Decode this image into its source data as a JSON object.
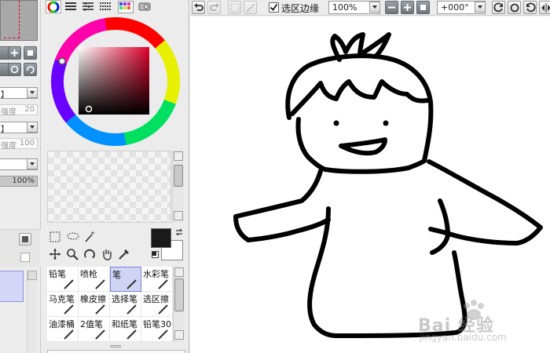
{
  "toolbar": {
    "selection_edge_checked": true,
    "selection_edge_label": "选区边缘",
    "zoom_value": "100%",
    "rotation_value": "+000°"
  },
  "left_panel": {
    "layer_mode_1": "】",
    "strength_1_label": "强度",
    "strength_1_value": "20",
    "layer_mode_2": "】",
    "strength_2_label": "强度",
    "strength_2_value": "100",
    "opacity_value": "100%"
  },
  "colors": {
    "primary": "#1a1a1a",
    "secondary": "#ffffff",
    "accent_selected": "#cfd4f5"
  },
  "brushes": [
    {
      "label": "铅笔",
      "icon": "pencil-icon"
    },
    {
      "label": "喷枪",
      "icon": "airbrush-icon"
    },
    {
      "label": "笔",
      "icon": "pen-icon"
    },
    {
      "label": "水彩笔",
      "icon": "watercolor-icon"
    },
    {
      "label": "马克笔",
      "icon": "marker-icon"
    },
    {
      "label": "橡皮擦",
      "icon": "eraser-icon"
    },
    {
      "label": "选择笔",
      "icon": "select-pen-icon"
    },
    {
      "label": "选区擦",
      "icon": "select-eraser-icon"
    },
    {
      "label": "油漆桶",
      "icon": "bucket-icon"
    },
    {
      "label": "2值笔",
      "icon": "binary-pen-icon"
    },
    {
      "label": "和纸笔",
      "icon": "washi-pen-icon"
    },
    {
      "label": "铅笔30",
      "icon": "pencil30-icon"
    }
  ],
  "selected_brush": "笔",
  "watermark": {
    "main": "Bai 经验",
    "sub": "jingyan.baidu.com"
  }
}
